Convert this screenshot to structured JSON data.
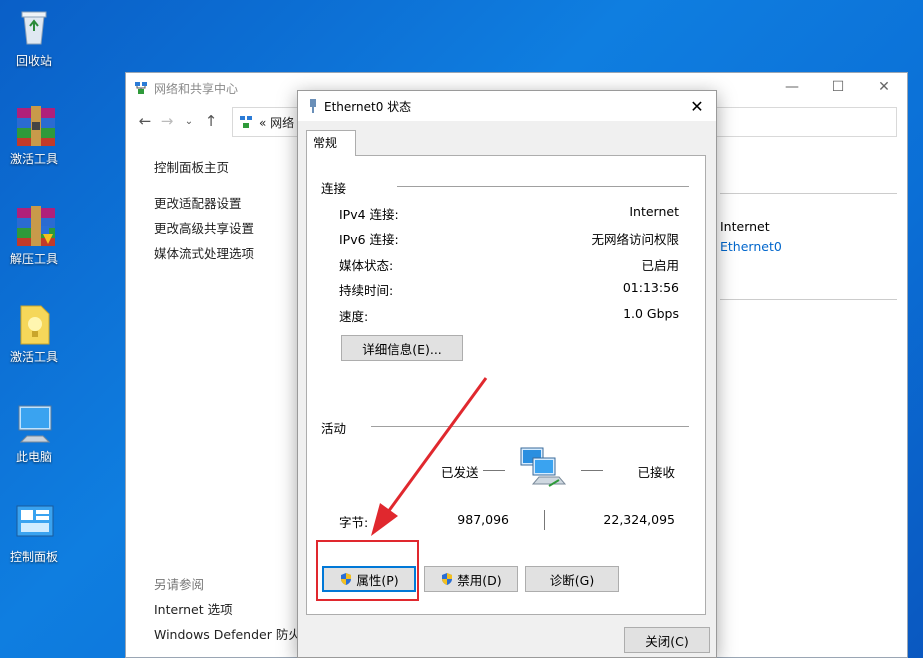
{
  "desktop": {
    "icons": [
      {
        "label": "回收站"
      },
      {
        "label": "激活工具"
      },
      {
        "label": "解压工具"
      },
      {
        "label": "激活工具"
      },
      {
        "label": "此电脑"
      },
      {
        "label": "控制面板"
      }
    ]
  },
  "bg_window": {
    "title": "网络和共享中心",
    "address": "«  网络",
    "sidebar": {
      "home": "控制面板主页",
      "links": [
        "更改适配器设置",
        "更改高级共享设置",
        "媒体流式处理选项"
      ],
      "see_also_title": "另请参阅",
      "see_also": [
        "Internet 选项",
        "Windows Defender 防火墙"
      ]
    },
    "right": {
      "access_type": "Internet",
      "connection_link": "Ethernet0"
    }
  },
  "dialog": {
    "title": "Ethernet0 状态",
    "tab": "常规",
    "connection": {
      "header": "连接",
      "rows": [
        {
          "label": "IPv4 连接:",
          "value": "Internet"
        },
        {
          "label": "IPv6 连接:",
          "value": "无网络访问权限"
        },
        {
          "label": "媒体状态:",
          "value": "已启用"
        },
        {
          "label": "持续时间:",
          "value": "01:13:56"
        },
        {
          "label": "速度:",
          "value": "1.0 Gbps"
        }
      ],
      "details_button": "详细信息(E)..."
    },
    "activity": {
      "header": "活动",
      "sent_label": "已发送",
      "received_label": "已接收",
      "bytes_label": "字节:",
      "bytes_sent": "987,096",
      "bytes_received": "22,324,095"
    },
    "buttons": {
      "properties": "属性(P)",
      "disable": "禁用(D)",
      "diagnose": "诊断(G)",
      "close": "关闭(C)"
    }
  },
  "colors": {
    "accent": "#0078d7",
    "highlight": "#e0282e",
    "link": "#0066cc"
  }
}
